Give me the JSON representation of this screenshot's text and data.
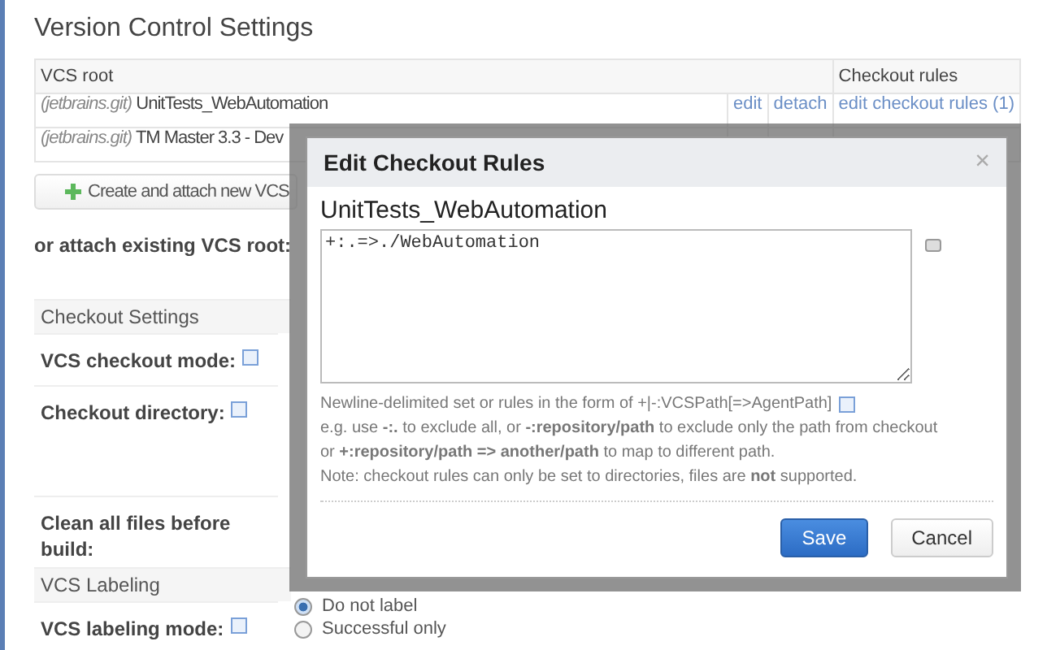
{
  "page": {
    "title": "Version Control Settings"
  },
  "vcs_table": {
    "columns": [
      {
        "label": "VCS root"
      },
      {
        "label": "Checkout rules"
      }
    ],
    "rows": [
      {
        "type": "(jetbrains.git)",
        "name": "UnitTests_WebAutomation",
        "actions": [
          "edit",
          "detach",
          "edit checkout rules (1)"
        ]
      },
      {
        "type": "(jetbrains.git)",
        "name": "TM Master 3.3 - Dev",
        "actions": []
      }
    ]
  },
  "create_button": "Create and attach new VCS",
  "attach_label": "or attach existing VCS root:",
  "sections": [
    {
      "title": "Checkout Settings",
      "fields": [
        {
          "label": "VCS checkout mode:",
          "help": true
        },
        {
          "label": "Checkout directory:",
          "help": true
        },
        {
          "label": "Clean all files before build:",
          "help": false
        }
      ]
    },
    {
      "title": "VCS Labeling",
      "fields": [
        {
          "label": "VCS labeling mode:",
          "help": true
        }
      ]
    }
  ],
  "labeling_options": [
    {
      "label": "Do not label",
      "selected": true
    },
    {
      "label": "Successful only",
      "selected": false
    }
  ],
  "dialog": {
    "title": "Edit Checkout Rules",
    "close": "×",
    "root_name": "UnitTests_WebAutomation",
    "rules": "+:.=>./WebAutomation",
    "help_lines": [
      "Newline-delimited set or rules in the form of +|-:VCSPath[=>AgentPath]",
      "e.g. use **-:.** to exclude all, or **-:repository/path** to exclude only the path from checkout",
      "or **+:repository/path => another/path** to map to different path.",
      "Note: checkout rules can only be set to directories, files are **not** supported."
    ],
    "buttons": [
      {
        "label": "Save",
        "kind": "primary"
      },
      {
        "label": "Cancel",
        "kind": "secondary"
      }
    ]
  }
}
